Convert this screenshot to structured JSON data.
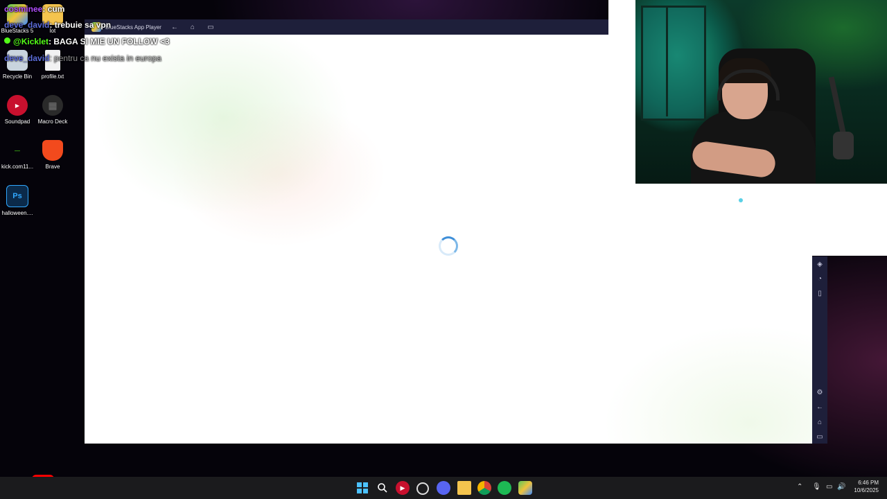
{
  "desktop": {
    "icons": [
      {
        "label": "BlueStacks 5",
        "icon": "bluestacks-icon"
      },
      {
        "label": "lot",
        "icon": "folder-icon"
      },
      {
        "label": "Recycle Bin",
        "icon": "recycle-bin-icon"
      },
      {
        "label": "profile.txt",
        "icon": "text-file-icon"
      },
      {
        "label": "Soundpad",
        "icon": "soundpad-icon"
      },
      {
        "label": "Macro Deck",
        "icon": "macro-deck-icon"
      },
      {
        "label": "kick.com11...",
        "icon": "shortcut-icon"
      },
      {
        "label": "Brave",
        "icon": "brave-icon"
      },
      {
        "label": "halloween....",
        "icon": "photoshop-file-icon"
      }
    ]
  },
  "chat": {
    "lines": [
      {
        "user": "cosminee",
        "msg": ": cum"
      },
      {
        "user": "deve_david",
        "msg": ": trebuie sa vpn"
      },
      {
        "user": "@Kicklet",
        "msg": ": BAGA SI MIE UN FOLLOW <3"
      },
      {
        "user": "deve_david",
        "msg": ": pentru ca nu exista in europa"
      }
    ]
  },
  "bluestacks": {
    "title": "BlueStacks App Player",
    "colors": {
      "chrome": "#1e1f3a",
      "spinner": "#3f8fd8"
    }
  },
  "taskbar": {
    "time": "6:46 PM",
    "date": "10/6/2025",
    "apps": [
      "start-icon",
      "search-icon",
      "soundpad-icon",
      "obs-icon",
      "discord-icon",
      "file-explorer-icon",
      "chrome-icon",
      "spotify-icon",
      "bluestacks-icon"
    ]
  }
}
